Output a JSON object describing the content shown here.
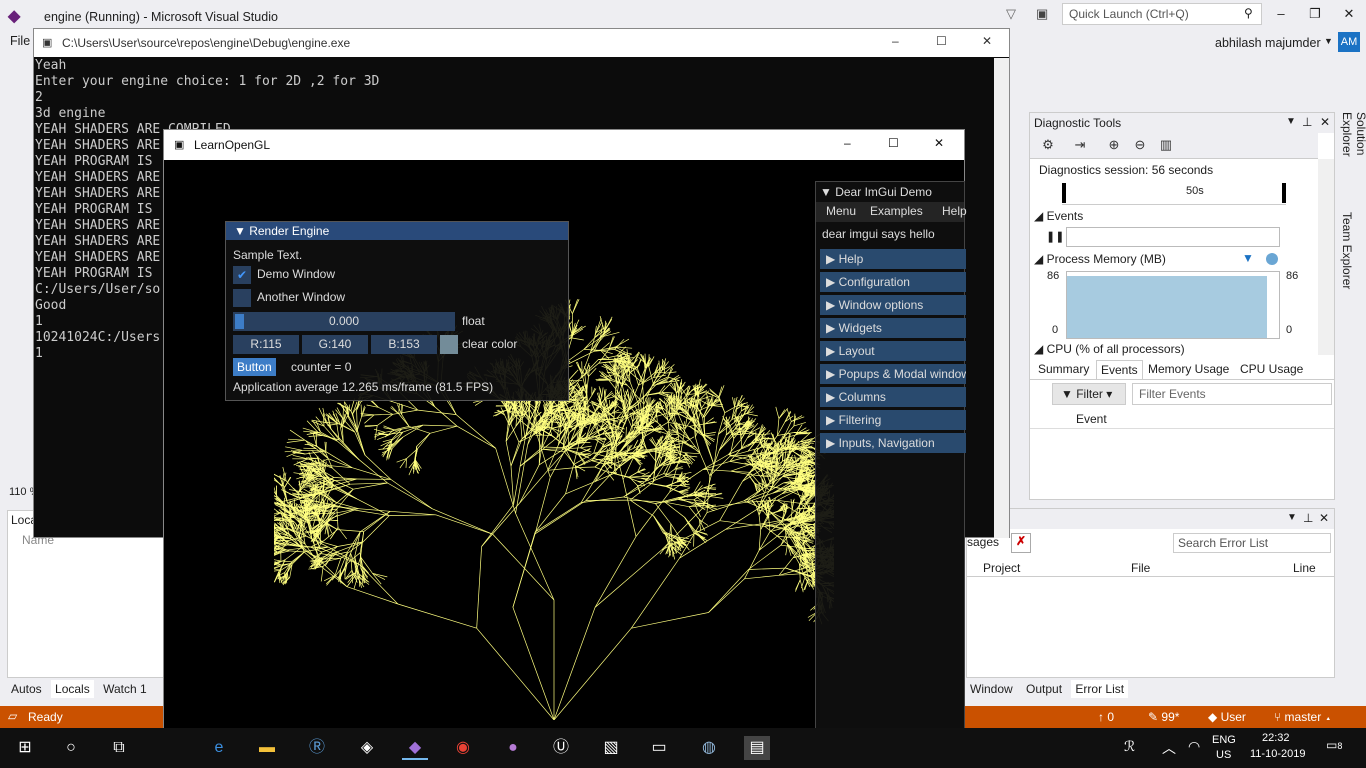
{
  "vs": {
    "title": "engine (Running) - Microsoft Visual Studio",
    "quick_launch": "Quick Launch (Ctrl+Q)",
    "user": "abhilash majumder",
    "avatar": "AM",
    "menu_file": "File",
    "zoom": "110 %"
  },
  "console": {
    "title": "C:\\Users\\User\\source\\repos\\engine\\Debug\\engine.exe",
    "lines": "Yeah\nEnter your engine choice: 1 for 2D ,2 for 3D\n2\n3d engine\nYEAH SHADERS ARE COMPILED\nYEAH SHADERS ARE\nYEAH PROGRAM IS\nYEAH SHADERS ARE\nYEAH SHADERS ARE\nYEAH PROGRAM IS\nYEAH SHADERS ARE\nYEAH SHADERS ARE\nYEAH SHADERS ARE\nYEAH PROGRAM IS\nC:/Users/User/so\nGood\n1\n10241024C:/Users\n1"
  },
  "gl": {
    "title": "LearnOpenGL",
    "tree_color": "#ffff80"
  },
  "render_engine": {
    "title": "Render Engine",
    "sample_text": "Sample Text.",
    "demo_window": "Demo Window",
    "another_window": "Another Window",
    "float_value": "0.000",
    "float_label": "float",
    "r": "R:115",
    "g": "G:140",
    "b": "B:153",
    "clear_color_label": "clear color",
    "clear_color": "#738c99",
    "button": "Button",
    "counter": "counter = 0",
    "fps": "Application average 12.265 ms/frame (81.5 FPS)"
  },
  "demo": {
    "title": "Dear ImGui Demo",
    "menu": [
      "Menu",
      "Examples",
      "Help"
    ],
    "hello": "dear imgui says hello",
    "items": [
      "Help",
      "Configuration",
      "Window options",
      "Widgets",
      "Layout",
      "Popups & Modal windows",
      "Columns",
      "Filtering",
      "Inputs, Navigation"
    ]
  },
  "diag": {
    "title": "Diagnostic Tools",
    "session": "Diagnostics session: 56 seconds",
    "ruler": "50s",
    "events": "Events",
    "memory": "Process Memory (MB)",
    "mem_max": "86",
    "mem_min": "0",
    "mem_max_r": "86",
    "mem_min_r": "0",
    "cpu": "CPU (% of all processors)",
    "tabs": [
      "Summary",
      "Events",
      "Memory Usage",
      "CPU Usage"
    ],
    "filter": "Filter",
    "filter_events": "Filter Events",
    "event_col": "Event"
  },
  "side_tabs": [
    "Solution Explorer",
    "Team Explorer"
  ],
  "errors": {
    "tab_frag": "sages",
    "search": "Search Error List",
    "cols": [
      "Project",
      "File",
      "Line"
    ]
  },
  "bottom_right_tabs": [
    "Window",
    "Output",
    "Error List"
  ],
  "locals": {
    "title": "Loca",
    "col": "Name",
    "tabs": [
      "Autos",
      "Locals",
      "Watch 1"
    ]
  },
  "status": {
    "ready": "Ready",
    "up": "0",
    "edits": "99*",
    "user": "User",
    "branch": "master"
  },
  "taskbar": {
    "lang": "ENG",
    "region": "US",
    "time": "22:32",
    "date": "11-10-2019",
    "notif": "8"
  }
}
